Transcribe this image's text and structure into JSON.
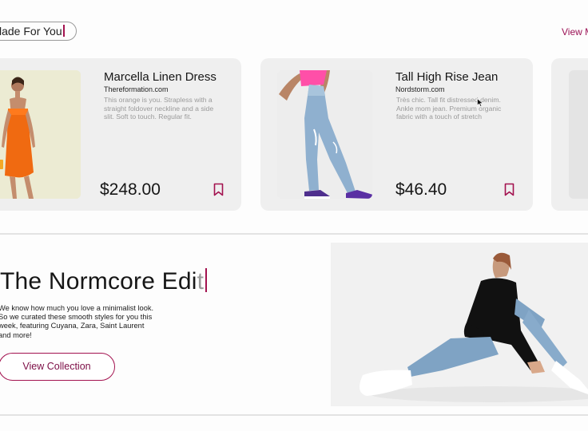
{
  "section": {
    "title": "lade For You",
    "view_more": "View M"
  },
  "products": [
    {
      "title": "Marcella Linen Dress",
      "store": "Thereformation.com",
      "description": "This orange is you. Strapless with a straight foldover neckline and a side slit. Soft to touch. Regular fit.",
      "price": "$248.00"
    },
    {
      "title": "Tall High Rise Jean",
      "store": "Nordstorm.com",
      "description": "Très chic. Tall fit distressed denim. Ankle mom jean. Premium organic fabric with a touch of stretch",
      "price": "$46.40"
    }
  ],
  "edit": {
    "title_main": "The Normcore Edi",
    "title_ghost": "t",
    "description": "We know how much you love a minimalist look. So we curated these smooth styles for you this week, featuring Cuyana, Zara, Saint Laurent and more!",
    "button_label": "View Collection"
  },
  "colors": {
    "accent": "#a3124f",
    "card_bg": "#efefef"
  }
}
